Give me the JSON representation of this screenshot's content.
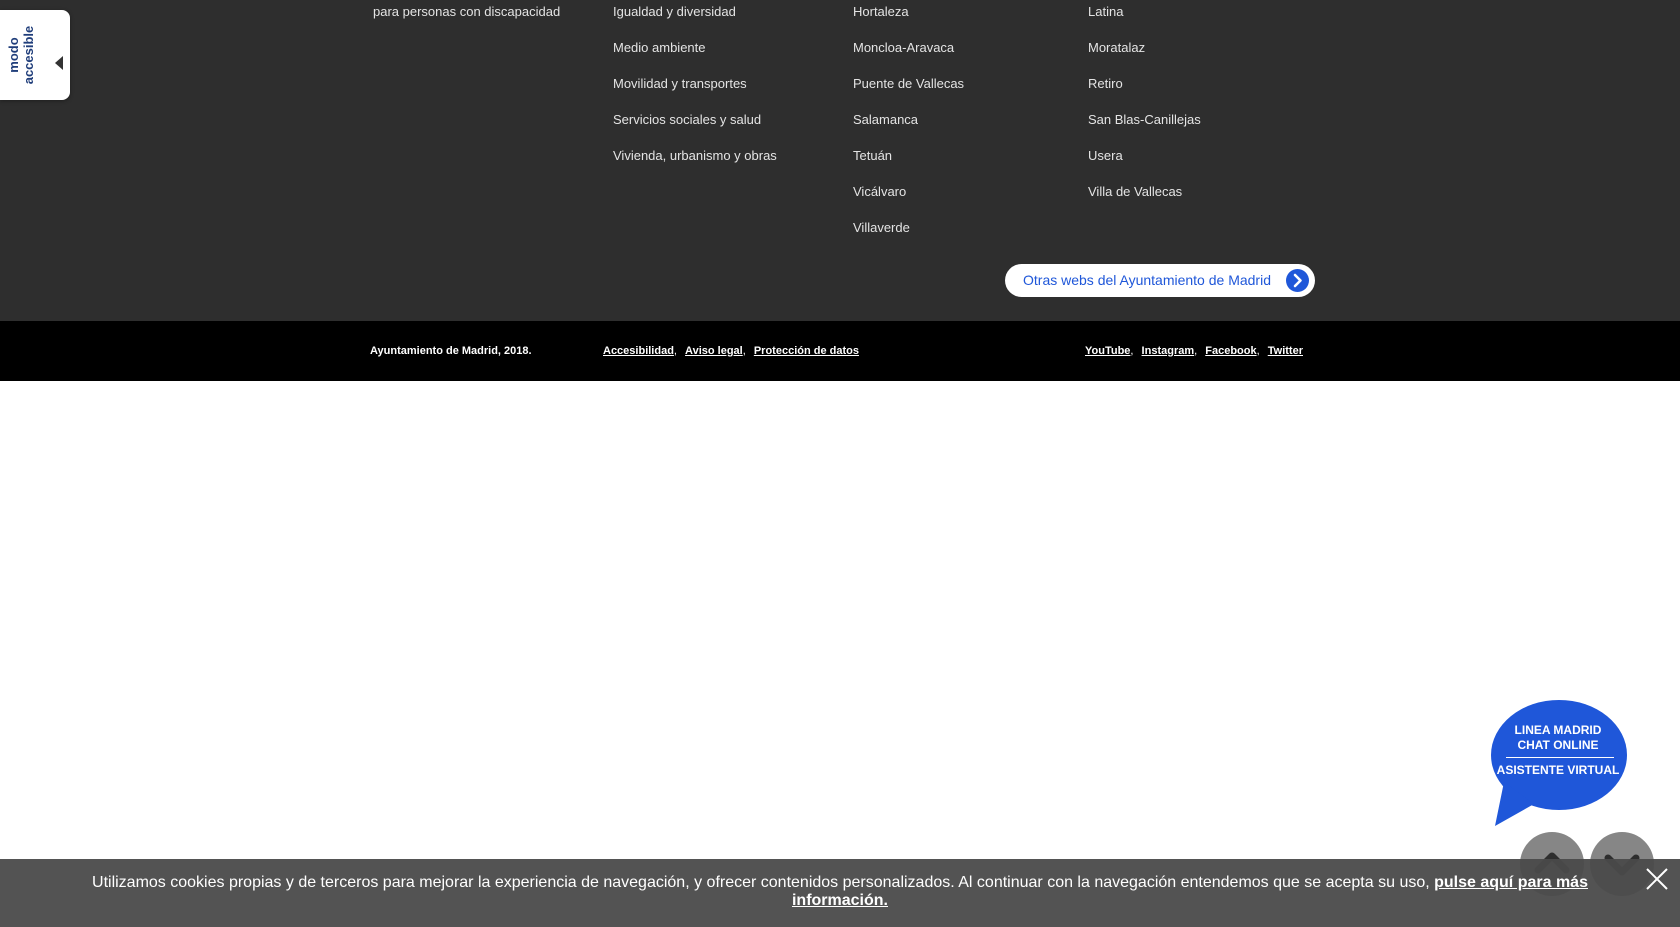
{
  "footer_menu": {
    "column_1": [
      "para personas con discapacidad"
    ],
    "column_2": [
      "Igualdad y diversidad",
      "Medio ambiente",
      "Movilidad y transportes",
      "Servicios sociales y salud",
      "Vivienda, urbanismo y obras"
    ],
    "column_3": [
      "Hortaleza",
      "Moncloa-Aravaca",
      "Puente de Vallecas",
      "Salamanca",
      "Tetuán",
      "Vicálvaro",
      "Villaverde"
    ],
    "column_4": [
      "Latina",
      "Moratalaz",
      "Retiro",
      "San Blas-Canillejas",
      "Usera",
      "Villa de Vallecas"
    ],
    "other_webs_label": "Otras webs del Ayuntamiento de Madrid",
    "other_webs_icon": "chevron-right-circle-icon"
  },
  "legal_bar": {
    "copyright": "Ayuntamiento de Madrid, 2018.",
    "legal_links": [
      "Accesibilidad",
      "Aviso legal",
      "Protección de datos"
    ],
    "social_links": [
      "YouTube",
      "Instagram",
      "Facebook",
      "Twitter"
    ],
    "separator": ","
  },
  "accessible_tab": {
    "line1": "modo",
    "line2": "accesible",
    "icon": "triangle-left-icon"
  },
  "chat": {
    "line1": "LINEA MADRID",
    "line2": "CHAT ONLINE",
    "line3": "ASISTENTE VIRTUAL",
    "color": "#1f57d9"
  },
  "scroll": {
    "up_icon": "chevron-up-icon",
    "down_icon": "chevron-down-icon"
  },
  "cookie": {
    "text": "Utilizamos cookies propias y de terceros para mejorar la experiencia de navegación, y ofrecer contenidos personalizados. Al continuar con la navegación entendemos que se acepta su uso, ",
    "link": "pulse aquí para más información.",
    "close_icon": "close-icon"
  },
  "colors": {
    "footer_bg": "#2e2e2e",
    "legal_bg": "#000000",
    "accent": "#1f57d9",
    "cookie_bg": "#4a4a4a"
  }
}
